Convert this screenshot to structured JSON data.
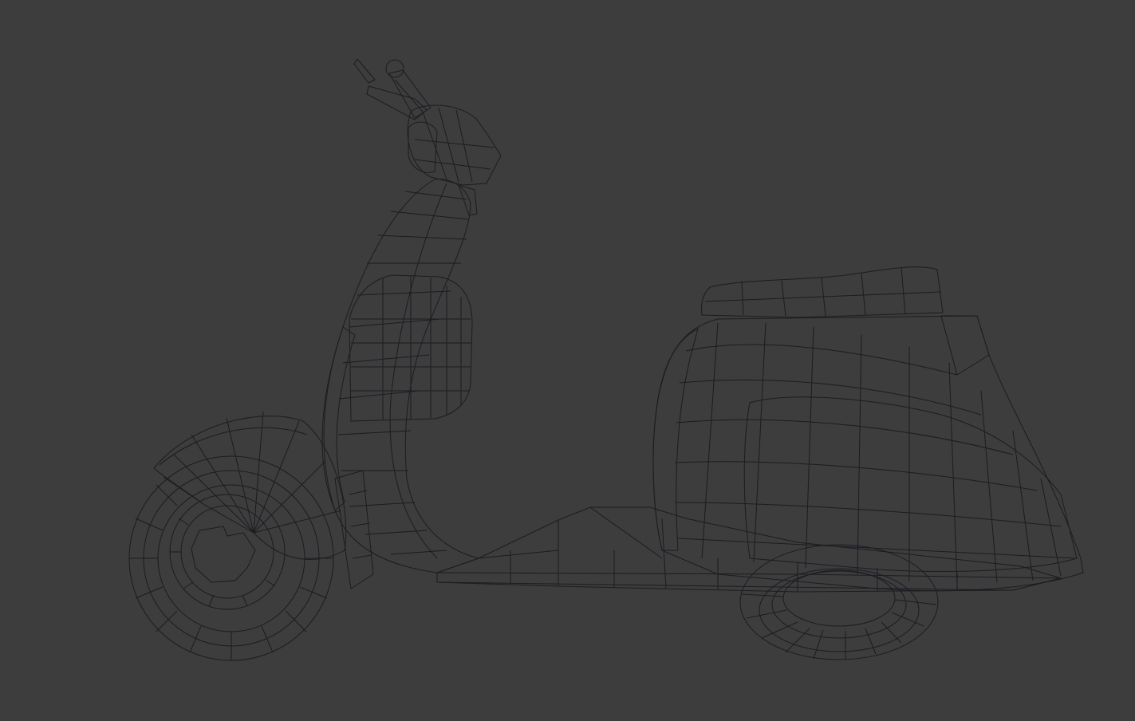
{
  "viewport": {
    "background": "#3d3d3d",
    "shading": "solid",
    "overlay": "wireframe-edges"
  },
  "model": {
    "object": "scooter",
    "parts": [
      "handlebar",
      "headset",
      "front-fork",
      "leg-shield",
      "glove-box",
      "front-fender",
      "front-wheel",
      "floorboard",
      "rear-body-cowl",
      "seat",
      "rear-wheel"
    ]
  },
  "colors": {
    "background": "#3d3d3d",
    "mesh_light": "#eeeef6",
    "mesh_mid": "#c8c8d6",
    "mesh_shadow": "#8c8ca2",
    "mesh_blue_tint": "#c3c8f0",
    "wire": "#1c1c22"
  }
}
